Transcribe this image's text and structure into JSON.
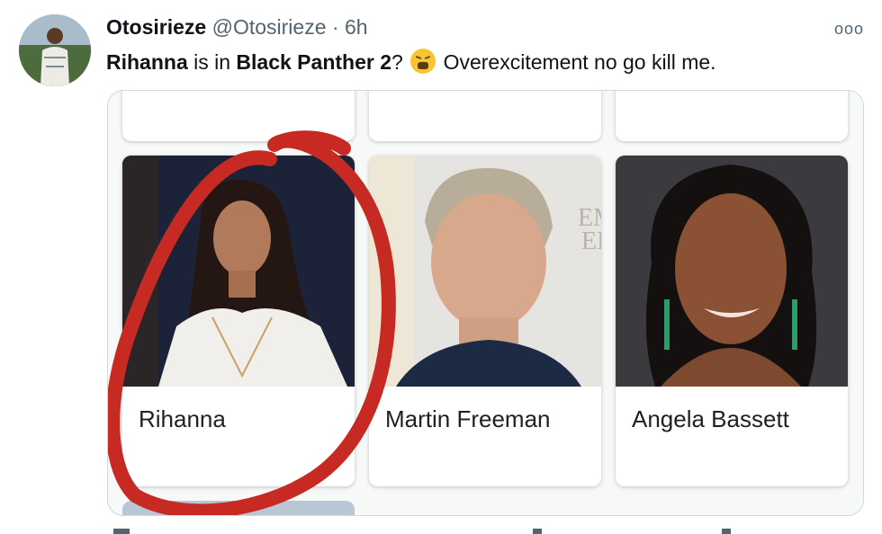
{
  "tweet": {
    "display_name": "Otosirieze",
    "handle": "@Otosirieze",
    "separator": "·",
    "time": "6h",
    "more_glyph": "ooo",
    "text_part1": "Rihanna",
    "text_part2": " is in ",
    "text_part3": "Black Panther 2",
    "text_part4": "?",
    "text_part5": "Overexcitement no go kill me.",
    "emoji": "weary-face"
  },
  "cast": [
    {
      "name": "Rihanna"
    },
    {
      "name": "Martin Freeman"
    },
    {
      "name": "Angela Bassett"
    }
  ],
  "colors": {
    "circle": "#c62a22",
    "handle": "#536471",
    "card_bg": "#ffffff",
    "media_bg": "#f7f9f9"
  }
}
